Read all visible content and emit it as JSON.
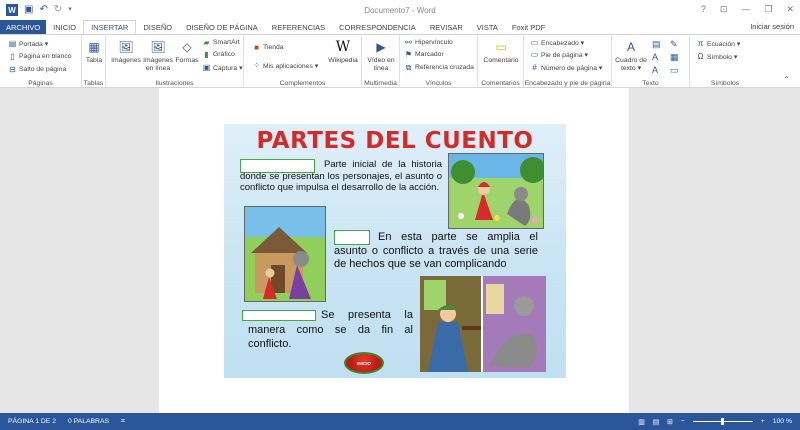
{
  "titlebar": {
    "title": "Documento7 - Word",
    "help": "?",
    "controls": [
      "⊡",
      "—",
      "❐",
      "✕"
    ]
  },
  "tabs": [
    "ARCHIVO",
    "INICIO",
    "INSERTAR",
    "DISEÑO",
    "DISEÑO DE PÁGINA",
    "REFERENCIAS",
    "CORRESPONDENCIA",
    "REVISAR",
    "VISTA",
    "Foxit PDF"
  ],
  "signin": "Iniciar sesión",
  "ribbon": {
    "paginas": {
      "label": "Páginas",
      "items": [
        "Portada ▾",
        "Página en blanco",
        "Salto de página"
      ]
    },
    "tablas": {
      "label": "Tablas",
      "tabla": "Tabla"
    },
    "ilustraciones": {
      "label": "Ilustraciones",
      "imagenes": "Imágenes",
      "imagenes_linea": "Imágenes en línea",
      "formas": "Formas",
      "smartart": "SmartArt",
      "grafico": "Gráfico",
      "captura": "Captura ▾"
    },
    "complementos": {
      "label": "Complementos",
      "tienda": "Tienda",
      "mis_apps": "Mis aplicaciones ▾",
      "wikipedia": "Wikipedia"
    },
    "multimedia": {
      "label": "Multimedia",
      "video": "Vídeo en línea"
    },
    "vinculos": {
      "label": "Vínculos",
      "hipervinculo": "Hipervínculo",
      "marcador": "Marcador",
      "referencia": "Referencia cruzada"
    },
    "comentarios": {
      "label": "Comentarios",
      "comentario": "Comentario"
    },
    "encabezado": {
      "label": "Encabezado y pie de página",
      "encabezado": "Encabezado ▾",
      "pie": "Pie de página ▾",
      "numero": "Número de página ▾"
    },
    "texto": {
      "label": "Texto",
      "cuadro": "Cuadro de texto ▾"
    },
    "simbolos": {
      "label": "Símbolos",
      "ecuacion": "Ecuación ▾",
      "simbolo": "Símbolo ▾"
    }
  },
  "slide": {
    "title": "PARTES DEL CUENTO",
    "p1": "Parte inicial de la historia donde se presentan los personajes, el asunto o conflicto que impulsa el desarrollo de la acción.",
    "p2": "En esta parte se amplia el asunto o conflicto a través de una serie de hechos que se van complicando",
    "p3": "Se presenta la manera como se da fin al conflicto.",
    "button": "INICIO"
  },
  "statusbar": {
    "page": "PÁGINA 1 DE 2",
    "words": "0 PALABRAS",
    "zoom": "100 %"
  }
}
